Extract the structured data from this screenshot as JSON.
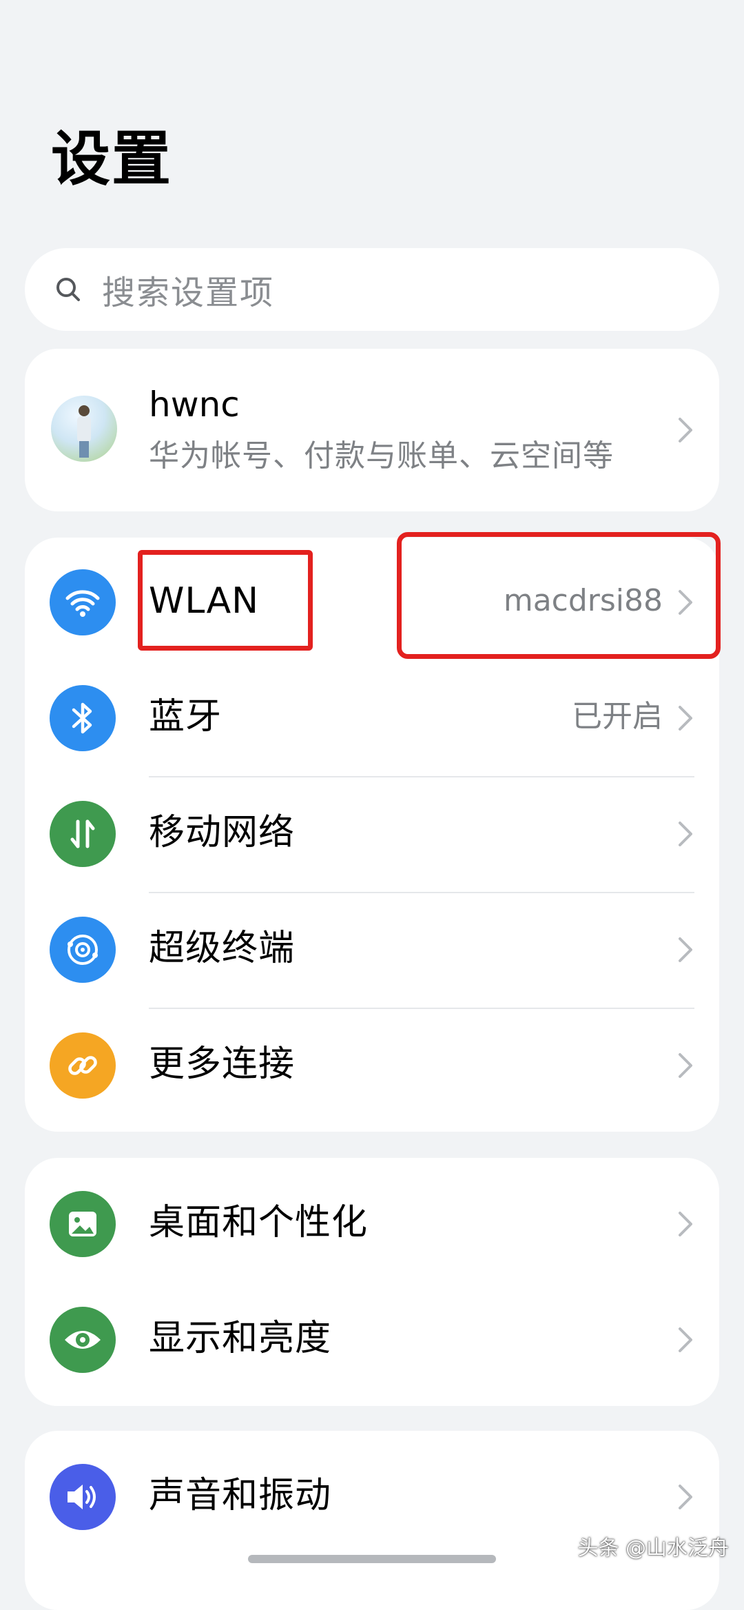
{
  "page": {
    "title": "设置"
  },
  "search": {
    "placeholder": "搜索设置项",
    "icon": "search-icon"
  },
  "account": {
    "name": "hwnc",
    "subtitle": "华为帐号、付款与账单、云空间等"
  },
  "connectivity": [
    {
      "label": "WLAN",
      "value": "macdrsi88",
      "icon": "wifi-icon",
      "color": "#2d8ef0"
    },
    {
      "label": "蓝牙",
      "value": "已开启",
      "icon": "bluetooth-icon",
      "color": "#2d8ef0"
    },
    {
      "label": "移动网络",
      "value": "",
      "icon": "mobile-data-icon",
      "color": "#3f9a4f"
    },
    {
      "label": "超级终端",
      "value": "",
      "icon": "super-device-icon",
      "color": "#2d8ef0"
    },
    {
      "label": "更多连接",
      "value": "",
      "icon": "link-icon",
      "color": "#f5a623"
    }
  ],
  "display": [
    {
      "label": "桌面和个性化",
      "icon": "wallpaper-icon",
      "color": "#3f9a4f"
    },
    {
      "label": "显示和亮度",
      "icon": "eye-icon",
      "color": "#3f9a4f"
    }
  ],
  "sound": [
    {
      "label": "声音和振动",
      "icon": "speaker-icon",
      "color": "#4a5ee8"
    }
  ],
  "annotation_color": "#e3211f",
  "watermark": "头条 @山水泛舟"
}
